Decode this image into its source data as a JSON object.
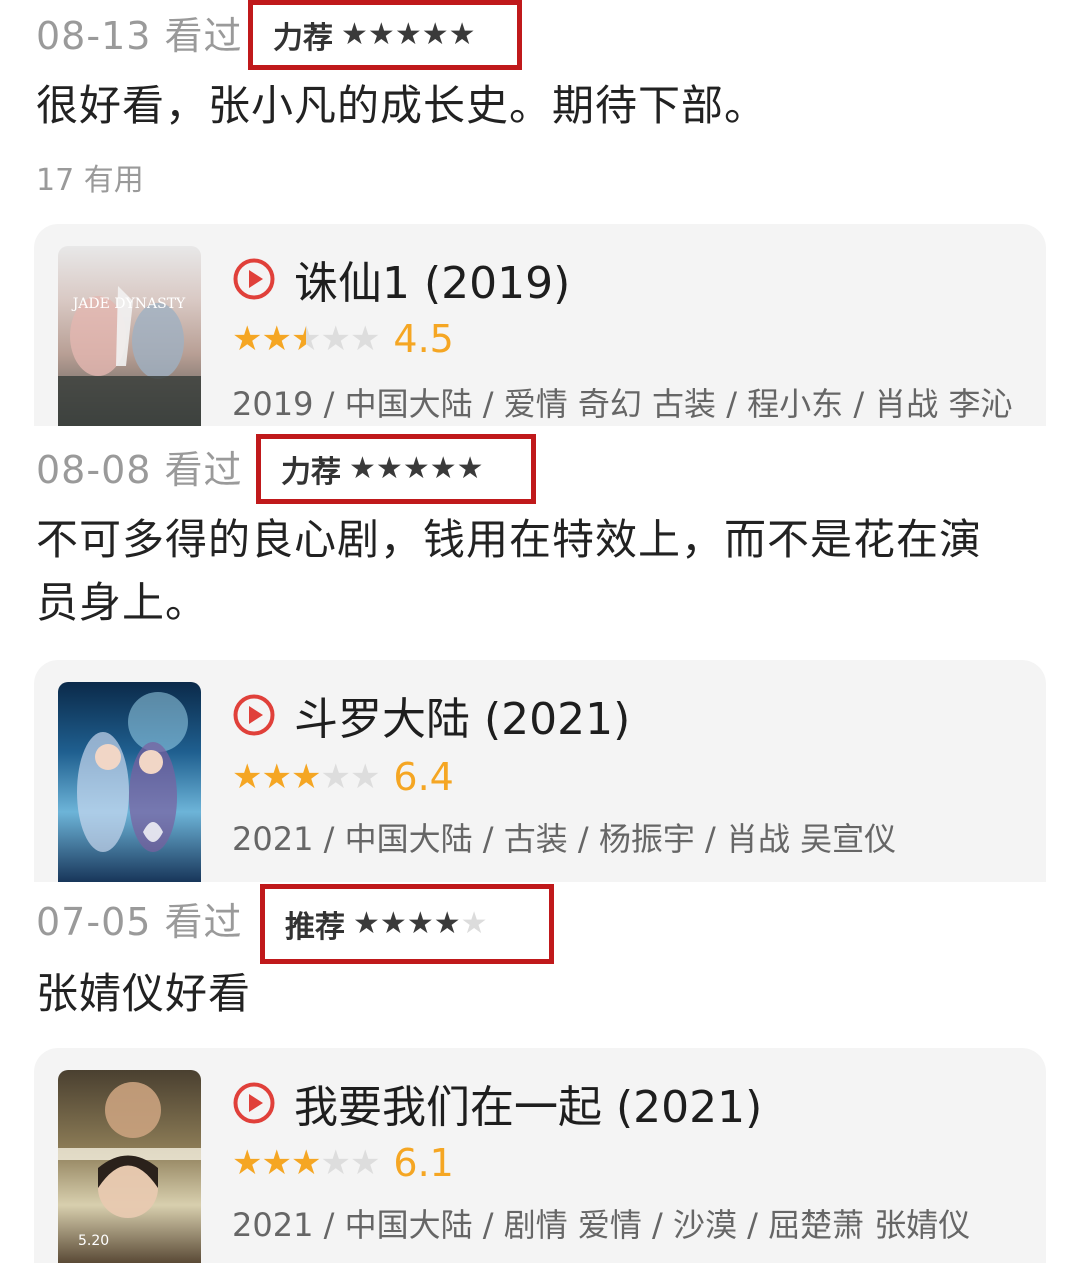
{
  "entries": [
    {
      "date": "08-13 看过",
      "rating_word": "力荐",
      "user_stars": 5,
      "comment": "很好看，张小凡的成长史。期待下部。",
      "useful": "17 有用",
      "movie": {
        "title": "诛仙1 (2019)",
        "stars": 2.5,
        "score": "4.5",
        "info": "2019 / 中国大陆 / 爱情 奇幻 古装 / 程小东 / 肖战 李沁",
        "poster_text": "JADE DYNASTY"
      }
    },
    {
      "date": "08-08 看过",
      "rating_word": "力荐",
      "user_stars": 5,
      "comment": "不可多得的良心剧，钱用在特效上，而不是花在演员身上。",
      "movie": {
        "title": "斗罗大陆 (2021)",
        "stars": 3,
        "score": "6.4",
        "info": "2021 / 中国大陆 / 古装 / 杨振宇 / 肖战 吴宣仪"
      }
    },
    {
      "date": "07-05 看过",
      "rating_word": "推荐",
      "user_stars": 4,
      "comment": "张婧仪好看",
      "movie": {
        "title": "我要我们在一起 (2021)",
        "stars": 3,
        "score": "6.1",
        "info": "2021 / 中国大陆 / 剧情 爱情 / 沙漠 / 屈楚萧 张婧仪",
        "poster_text": "5.20"
      }
    }
  ],
  "colors": {
    "highlight_box": "#c0191b",
    "star_orange": "#f5a623",
    "play_red": "#e0403a"
  }
}
